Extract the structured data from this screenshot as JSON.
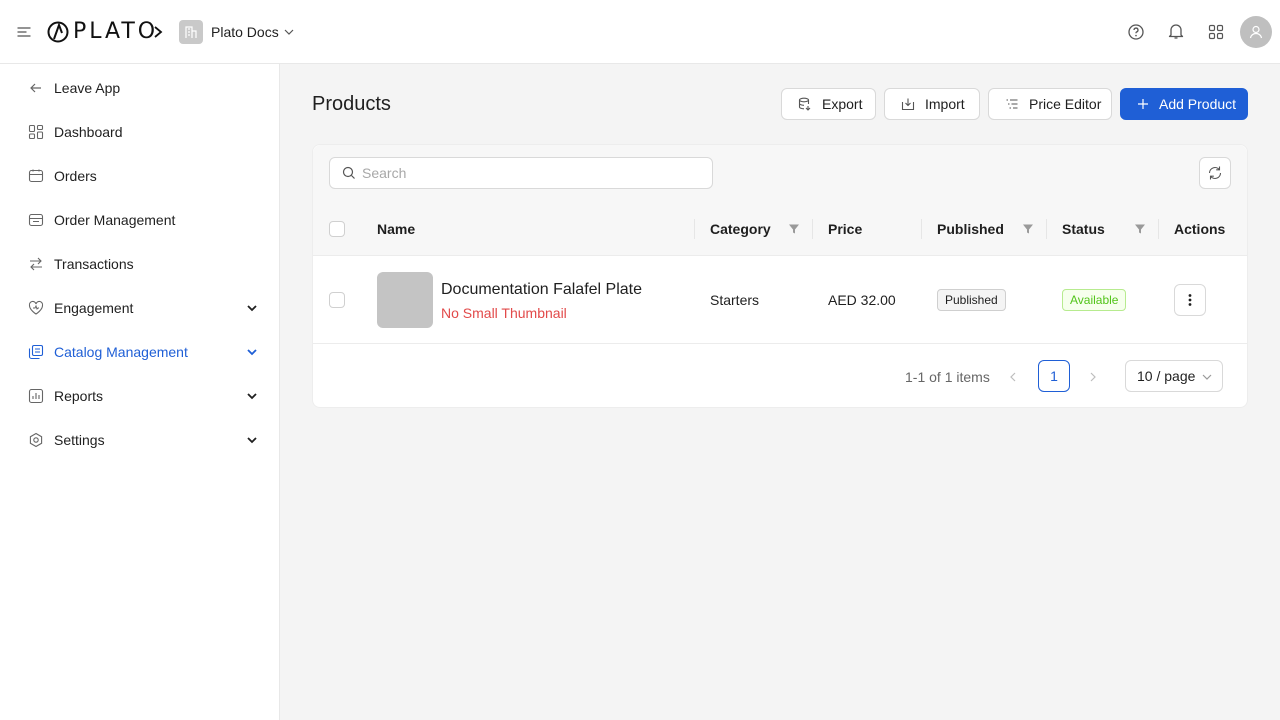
{
  "header": {
    "logo_text": "PLATO",
    "org_name": "Plato Docs",
    "icons": [
      "menu-icon",
      "chevron-right-icon",
      "building-icon",
      "chevron-down-icon",
      "help-icon",
      "bell-icon",
      "apps-grid-icon",
      "user-icon"
    ]
  },
  "sidebar": {
    "items": [
      {
        "label": "Leave App",
        "icon": "arrow-left-icon"
      },
      {
        "label": "Dashboard",
        "icon": "dashboard-icon"
      },
      {
        "label": "Orders",
        "icon": "orders-icon"
      },
      {
        "label": "Order Management",
        "icon": "order-management-icon"
      },
      {
        "label": "Transactions",
        "icon": "transactions-icon"
      },
      {
        "label": "Engagement",
        "icon": "heart-icon",
        "expandable": true
      },
      {
        "label": "Catalog Management",
        "icon": "catalog-icon",
        "expandable": true,
        "active": true
      },
      {
        "label": "Reports",
        "icon": "reports-icon",
        "expandable": true
      },
      {
        "label": "Settings",
        "icon": "settings-icon",
        "expandable": true
      }
    ]
  },
  "main": {
    "title": "Products",
    "actions": {
      "export": "Export",
      "import": "Import",
      "price_editor": "Price Editor",
      "add_product": "Add Product"
    },
    "search": {
      "placeholder": "Search",
      "value": ""
    },
    "table": {
      "columns": [
        "Name",
        "Category",
        "Price",
        "Published",
        "Status",
        "Actions"
      ],
      "rows": [
        {
          "name": "Documentation Falafel Plate",
          "thumbnail_note": "No Small Thumbnail",
          "category": "Starters",
          "price": "AED 32.00",
          "published": "Published",
          "status": "Available"
        }
      ]
    },
    "pagination": {
      "info": "1-1 of 1 items",
      "current_page": "1",
      "page_size": "10 / page"
    }
  },
  "colors": {
    "accent": "#1f5fd6",
    "warning_text": "#e24a4a",
    "status_available": "#52c41a"
  }
}
